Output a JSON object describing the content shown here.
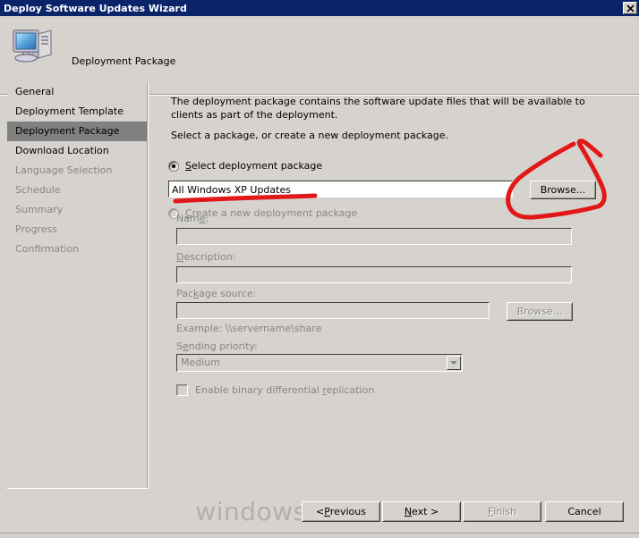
{
  "window": {
    "title": "Deploy Software Updates Wizard",
    "close_label": "✕",
    "titlebar_color": "#0a246a",
    "face_color": "#d6d3ce"
  },
  "header": {
    "title": "Deployment Package",
    "icon": "computer-icon"
  },
  "sidebar": {
    "items": [
      {
        "label": "General",
        "state": "normal"
      },
      {
        "label": "Deployment Template",
        "state": "normal"
      },
      {
        "label": "Deployment Package",
        "state": "selected"
      },
      {
        "label": "Download Location",
        "state": "normal"
      },
      {
        "label": "Language Selection",
        "state": "disabled"
      },
      {
        "label": "Schedule",
        "state": "disabled"
      },
      {
        "label": "Summary",
        "state": "disabled"
      },
      {
        "label": "Progress",
        "state": "disabled"
      },
      {
        "label": "Confirmation",
        "state": "disabled"
      }
    ],
    "selected_bg": "#808080"
  },
  "content": {
    "paragraph1": "The deployment package contains the software update files that will be available to clients as part of the deployment.",
    "paragraph2": "Select a package, or create a new deployment package.",
    "radio_select": {
      "label_before": "S",
      "label_after": "elect deployment package",
      "checked": true
    },
    "package_field": {
      "value": "All Windows XP Updates",
      "placeholder": ""
    },
    "browse_button_1": "Browse...",
    "radio_create": {
      "label_before": "C",
      "label_after": "reate a new deployment package",
      "checked": false
    },
    "name_label_before": "Nam",
    "name_label_acc": "e",
    "name_label_after": ":",
    "name_field": {
      "value": "",
      "placeholder": ""
    },
    "description_label_acc": "D",
    "description_label_after": "escription:",
    "description_field": {
      "value": "",
      "placeholder": ""
    },
    "source_label_before": "Pac",
    "source_label_acc": "k",
    "source_label_after": "age source:",
    "source_field": {
      "value": "",
      "placeholder": ""
    },
    "browse_button_2": "Browse...",
    "example_text": "Example: \\\\servername\\share",
    "priority_label_before": "S",
    "priority_label_acc": "e",
    "priority_label_after": "nding priority:",
    "priority_value": "Medium",
    "priority_options": [
      "Medium"
    ],
    "checkbox": {
      "label_before": "Enable binary differential ",
      "label_acc": "r",
      "label_after": "eplication",
      "checked": false
    }
  },
  "footer": {
    "previous_before": "< ",
    "previous_acc": "P",
    "previous_after": "revious",
    "next_acc": "N",
    "next_after": "ext >",
    "finish_acc": "F",
    "finish_after": "inish",
    "finish_enabled": false,
    "cancel_label": "Cancel"
  },
  "watermark": {
    "text": "windows-noob.com",
    "color": "#b4b1ab"
  },
  "annotation": {
    "color": "#e01818",
    "shapes": [
      "underline-under-package-field",
      "circle-around-browse-button"
    ]
  }
}
